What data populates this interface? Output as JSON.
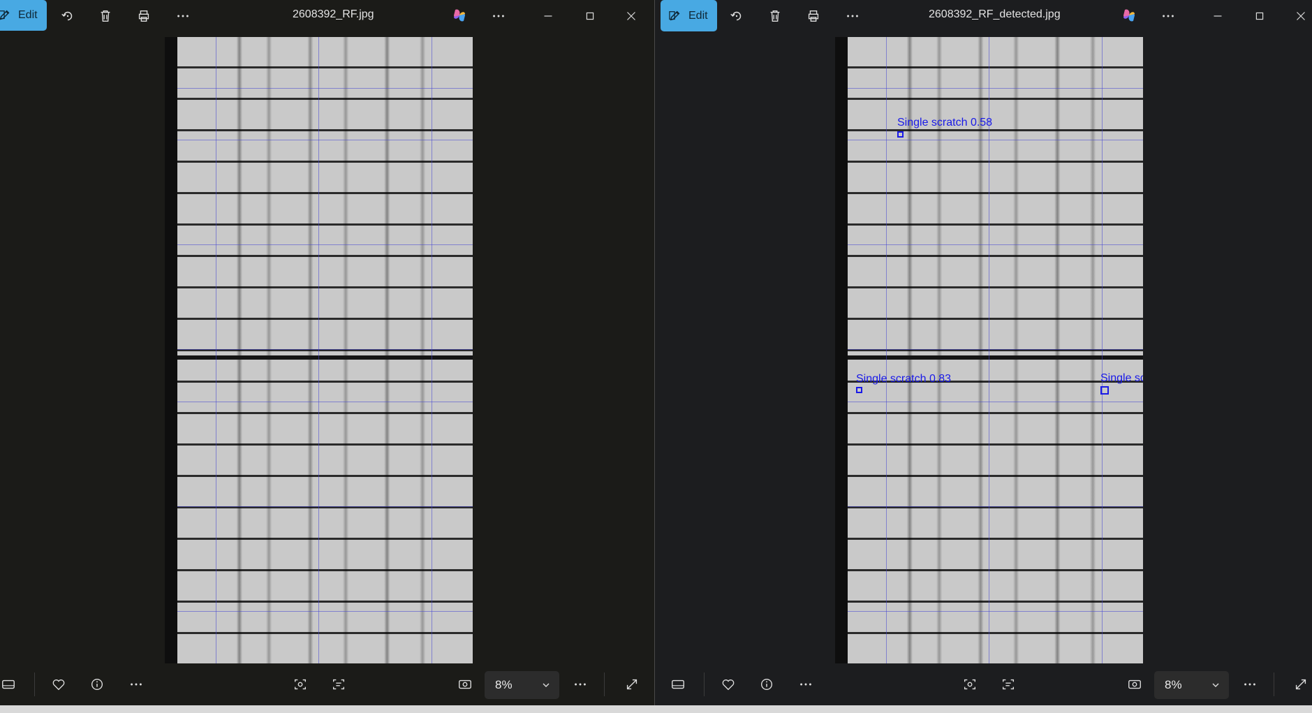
{
  "left": {
    "title": "2608392_RF.jpg",
    "edit_label": "Edit",
    "zoom": "8%"
  },
  "right": {
    "title": "2608392_RF_detected.jpg",
    "edit_label": "Edit",
    "zoom": "8%",
    "detections": [
      {
        "label": "Single scratch 0.58"
      },
      {
        "label": "Single scratch 0.83"
      },
      {
        "label": "Single sc"
      }
    ]
  },
  "colors": {
    "accent": "#48a9e3",
    "detection": "#1a1ae6"
  },
  "icons": [
    "edit-icon",
    "rotate-icon",
    "delete-icon",
    "print-icon",
    "more-icon",
    "copilot-icon",
    "minimize-icon",
    "maximize-icon",
    "close-icon",
    "filmstrip-icon",
    "favorite-icon",
    "info-icon",
    "visual-search-icon",
    "text-scan-icon",
    "actual-size-icon",
    "chevron-down-icon",
    "fullscreen-icon"
  ]
}
